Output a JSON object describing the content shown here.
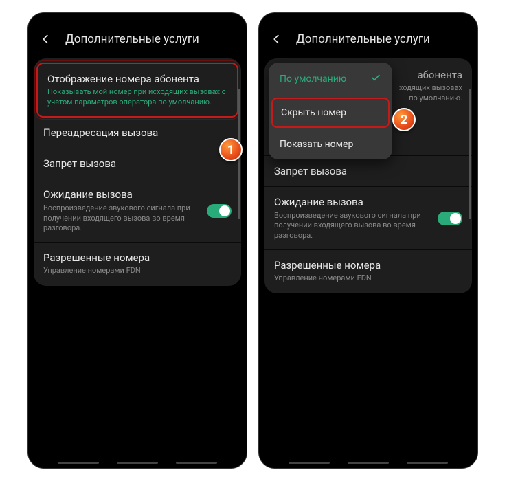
{
  "screen1": {
    "title": "Дополнительные услуги",
    "items": [
      {
        "title": "Отображение номера абонента",
        "sub": "Показывать мой номер при исходящих вызовах с учетом параметров оператора по умолчанию."
      },
      {
        "title": "Переадресация вызова"
      },
      {
        "title": "Запрет вызова"
      },
      {
        "title": "Ожидание вызова",
        "sub": "Воспроизведение звукового сигнала при получении входящего вызова во время разговора."
      },
      {
        "title": "Разрешенные номера",
        "sub": "Управление номерами FDN"
      }
    ],
    "marker": "1"
  },
  "screen2": {
    "title": "Дополнительные услуги",
    "popup": {
      "opt1": "По умолчанию",
      "opt2": "Скрыть номер",
      "opt3": "Показать номер"
    },
    "behind": {
      "title_fragment": "абонента",
      "sub_fragment": "ходящих вызовах\n по умолчанию."
    },
    "items": [
      {
        "title": "Запрет вызова"
      },
      {
        "title": "Ожидание вызова",
        "sub": "Воспроизведение звукового сигнала при получении входящего вызова во время разговора."
      },
      {
        "title": "Разрешенные номера",
        "sub": "Управление номерами FDN"
      }
    ],
    "marker": "2"
  }
}
